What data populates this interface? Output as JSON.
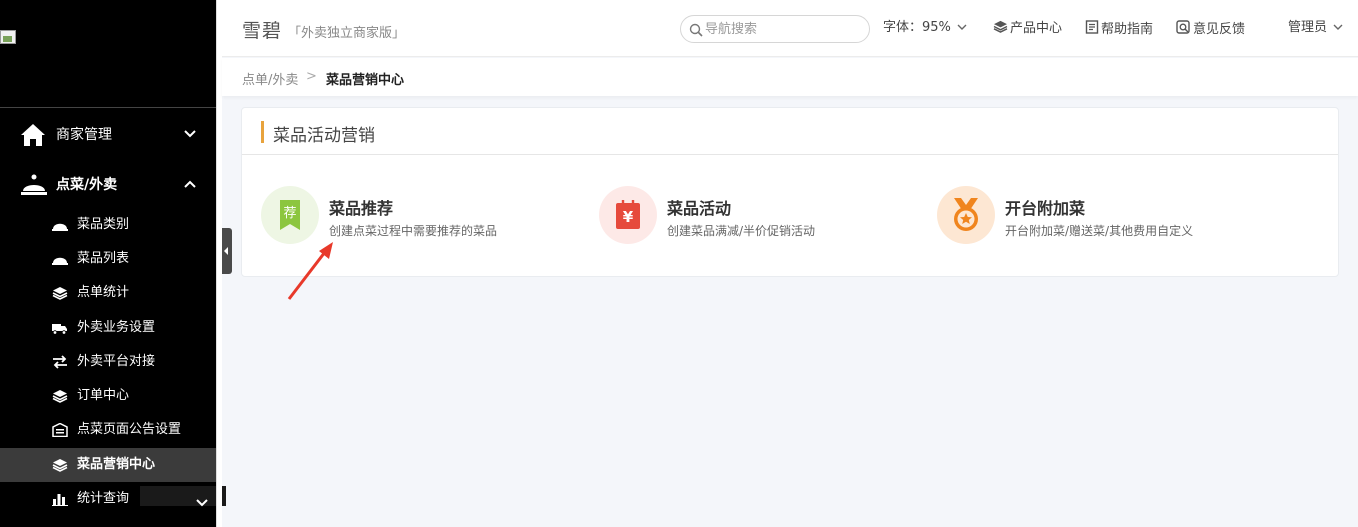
{
  "sidebar": {
    "parents": [
      {
        "label": "商家管理",
        "icon": "home-icon",
        "expanded": false
      },
      {
        "label": "点菜/外卖",
        "icon": "cloche-icon",
        "expanded": true
      }
    ],
    "children": [
      {
        "label": "菜品类别",
        "icon": "cloche-small-icon"
      },
      {
        "label": "菜品列表",
        "icon": "cloche-small-icon"
      },
      {
        "label": "点单统计",
        "icon": "layers-icon"
      },
      {
        "label": "外卖业务设置",
        "icon": "delivery-truck-icon"
      },
      {
        "label": "外卖平台对接",
        "icon": "swap-arrows-icon"
      },
      {
        "label": "订单中心",
        "icon": "layers-icon"
      },
      {
        "label": "点菜页面公告设置",
        "icon": "building-icon"
      },
      {
        "label": "菜品营销中心",
        "icon": "layers-icon",
        "active": true
      }
    ],
    "stats": {
      "label": "统计查询",
      "icon": "bar-chart-icon",
      "expanded": false
    }
  },
  "header": {
    "brand": "雪碧",
    "edition": "「外卖独立商家版」",
    "search_placeholder": "导航搜索",
    "font_size_label": "字体：95%",
    "product_center": "产品中心",
    "help_guide": "帮助指南",
    "feedback": "意见反馈",
    "admin": "管理员"
  },
  "breadcrumb": {
    "parent": "点单/外卖",
    "separator": ">",
    "current": "菜品营销中心"
  },
  "panel": {
    "title": "菜品活动营销",
    "cards": [
      {
        "name": "菜品推荐",
        "desc": "创建点菜过程中需要推荐的菜品",
        "icon": "recommend-tag-icon",
        "icon_glyph": "荐",
        "color": "#8cc63f",
        "bg": "#eef6e4"
      },
      {
        "name": "菜品活动",
        "desc": "创建菜品满减/半价促销活动",
        "icon": "yuan-bag-icon",
        "icon_glyph": "¥",
        "color": "#e64a3c",
        "bg": "#fde9e7"
      },
      {
        "name": "开台附加菜",
        "desc": "开台附加菜/赠送菜/其他费用自定义",
        "icon": "medal-icon",
        "color": "#f0851e",
        "bg": "#fde7d3"
      }
    ]
  },
  "colors": {
    "accent": "#e8a33d",
    "sidebar_bg": "#000000",
    "active_item_bg": "#3b3b3b",
    "annotation_arrow": "#e8392a"
  }
}
